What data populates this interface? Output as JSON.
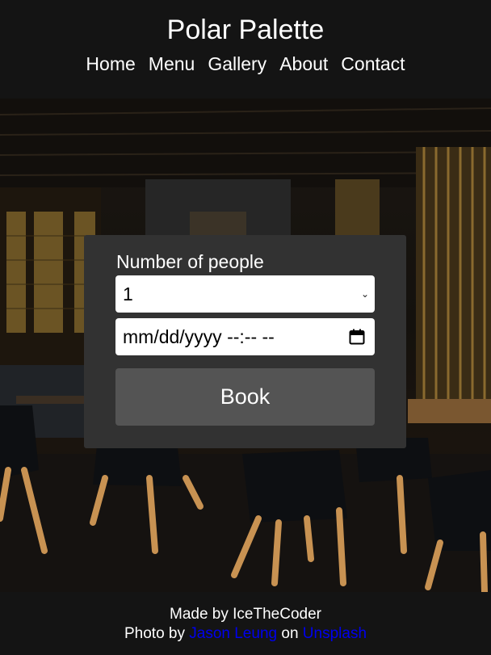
{
  "header": {
    "title": "Polar Palette",
    "nav": [
      "Home",
      "Menu",
      "Gallery",
      "About",
      "Contact"
    ]
  },
  "booking": {
    "people_label": "Number of people",
    "people_value": "1",
    "datetime_placeholder": "mm/dd/yyyy --:-- --",
    "book_label": "Book"
  },
  "footer": {
    "made_by": "Made by IceTheCoder",
    "photo_prefix": "Photo by",
    "photographer": "Jason Leung",
    "on": "on",
    "site": "Unsplash"
  },
  "colors": {
    "background": "#141414",
    "card": "#323232",
    "button": "#545454",
    "link": "#0000ee"
  }
}
